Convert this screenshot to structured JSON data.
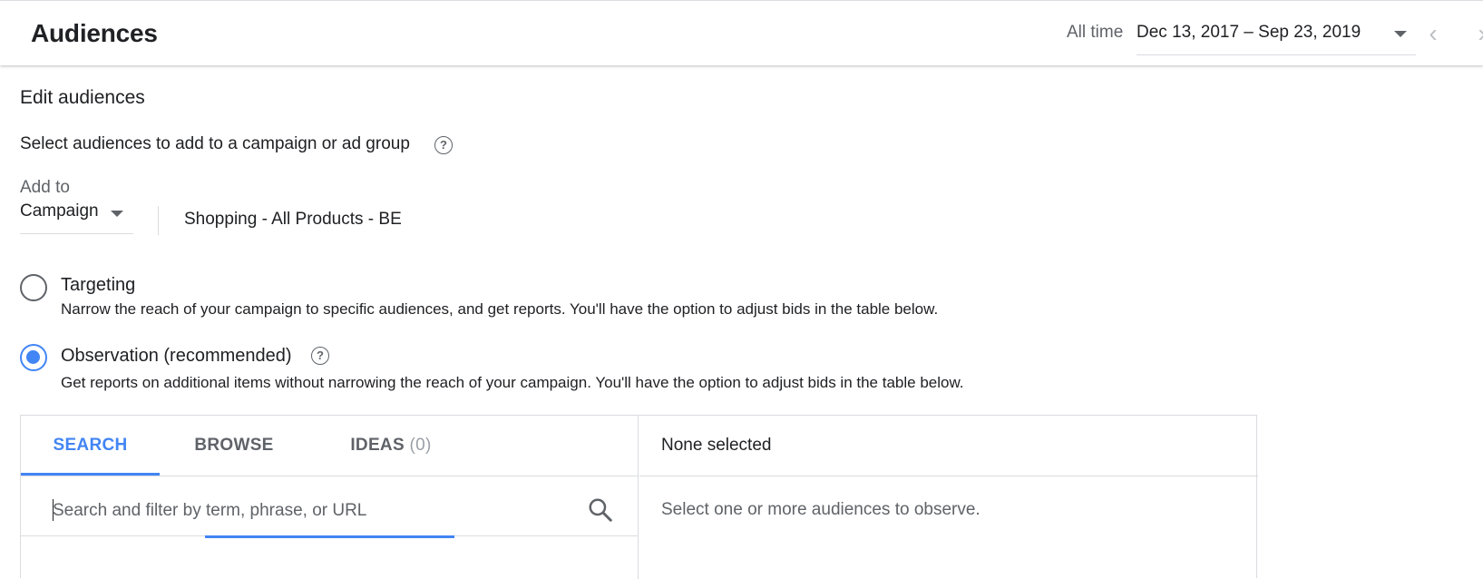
{
  "header": {
    "title": "Audiences",
    "date_range_label": "All time",
    "date_range_value": "Dec 13, 2017 – Sep 23, 2019",
    "prev_glyph": "‹",
    "next_glyph": "›"
  },
  "editor": {
    "section_title": "Edit audiences",
    "subtitle": "Select audiences to add to a campaign or ad group",
    "help_glyph": "?",
    "add_to_label": "Add to",
    "add_to_level": "Campaign",
    "selected_campaign": "Shopping - All Products - BE"
  },
  "targeting_options": {
    "selected": "observation",
    "targeting": {
      "label": "Targeting",
      "description": "Narrow the reach of your campaign to specific audiences, and get reports. You'll have the option to adjust bids in the table below."
    },
    "observation": {
      "label": "Observation (recommended)",
      "description": "Get reports on additional items without narrowing the reach of your campaign. You'll have the option to adjust bids in the table below."
    }
  },
  "picker": {
    "tabs": [
      {
        "label": "SEARCH",
        "active": true
      },
      {
        "label": "BROWSE",
        "active": false
      },
      {
        "label": "IDEAS",
        "count": "(0)",
        "active": false
      }
    ],
    "search_placeholder": "Search and filter by term, phrase, or URL",
    "search_value": "",
    "selected_title": "None selected",
    "empty_message": "Select one or more audiences to observe."
  },
  "colors": {
    "accent": "#4285f4",
    "text_primary": "#202124",
    "text_secondary": "#5f6368",
    "divider": "#dadce0"
  },
  "icons": {
    "help": "help-circle-icon",
    "search": "search-icon",
    "dropdown": "caret-down-icon",
    "prev": "chevron-left-icon",
    "next": "chevron-right-icon"
  }
}
